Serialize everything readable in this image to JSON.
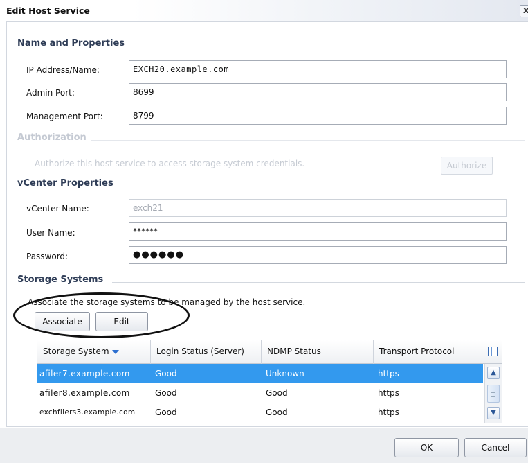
{
  "dialog": {
    "title": "Edit Host Service",
    "close_label": "x"
  },
  "name_properties": {
    "title": "Name and Properties",
    "ip_label": "IP Address/Name:",
    "ip_value": "EXCH20.example.com",
    "admin_port_label": "Admin Port:",
    "admin_port_value": "8699",
    "mgmt_port_label": "Management Port:",
    "mgmt_port_value": "8799"
  },
  "authorization": {
    "title": "Authorization",
    "description": "Authorize this host service to access storage system credentials.",
    "button": "Authorize"
  },
  "vcenter": {
    "title": "vCenter Properties",
    "name_label": "vCenter Name:",
    "name_value": "exch21",
    "user_label": "User Name:",
    "user_value": "******",
    "password_label": "Password:",
    "password_value": "●●●●●●"
  },
  "storage": {
    "title": "Storage Systems",
    "description": "Associate the storage systems to be managed by the host service.",
    "associate_button": "Associate",
    "edit_button": "Edit",
    "columns": [
      "Storage System",
      "Login Status (Server)",
      "NDMP Status",
      "Transport Protocol"
    ],
    "rows": [
      {
        "system": "afiler7.example.com",
        "login": "Good",
        "ndmp": "Unknown",
        "transport": "https"
      },
      {
        "system": "afiler8.example.com",
        "login": "Good",
        "ndmp": "Good",
        "transport": "https"
      },
      {
        "system": "exchfilers3.example.com",
        "login": "Good",
        "ndmp": "Good",
        "transport": "https"
      }
    ]
  },
  "footer": {
    "ok": "OK",
    "cancel": "Cancel"
  },
  "colors": {
    "selection": "#3399ee",
    "section_title": "#2f3d57",
    "annotation": "#111111"
  }
}
